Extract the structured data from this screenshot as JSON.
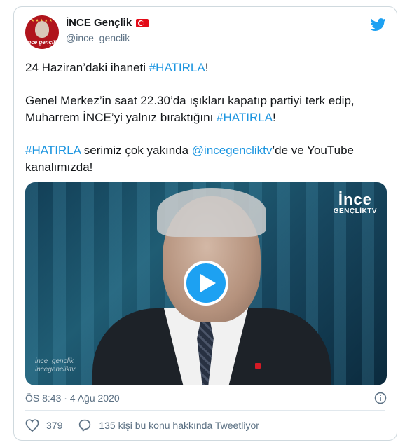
{
  "account": {
    "display_name": "İNCE Gençlik",
    "handle": "@ince_genclik",
    "avatar_text": "ince gençlik",
    "flag_icon": "turkey-flag-icon"
  },
  "tweet": {
    "p1": {
      "text": "24 Haziran’daki ihaneti ",
      "tag": "#HATIRLA",
      "tail": "!"
    },
    "p2": {
      "text": "Genel Merkez’in saat 22.30’da ışıkları kapatıp partiyi terk edip, Muharrem İNCE’yi yalnız bıraktığını ",
      "tag": "#HATIRLA",
      "tail": "!"
    },
    "p3": {
      "tag": "#HATIRLA",
      "mid": " serimiz çok yakında ",
      "mention": "@incegencliktv",
      "tail": "’de ve YouTube kanalımızda!"
    }
  },
  "media": {
    "brand_top": "İnce",
    "brand_bottom": "GENÇLİKTV",
    "watermark_1": "ince_genclik",
    "watermark_2": "incegencliktv",
    "play_icon": "play-icon"
  },
  "meta": {
    "timestamp": "ÖS 8:43 · 4 Ağu 2020"
  },
  "actions": {
    "likes": "379",
    "conversation": "135 kişi bu konu hakkında Tweetliyor"
  },
  "colors": {
    "link": "#1b95e0",
    "twitter_blue": "#1da1f2",
    "secondary_text": "#5b7083"
  }
}
